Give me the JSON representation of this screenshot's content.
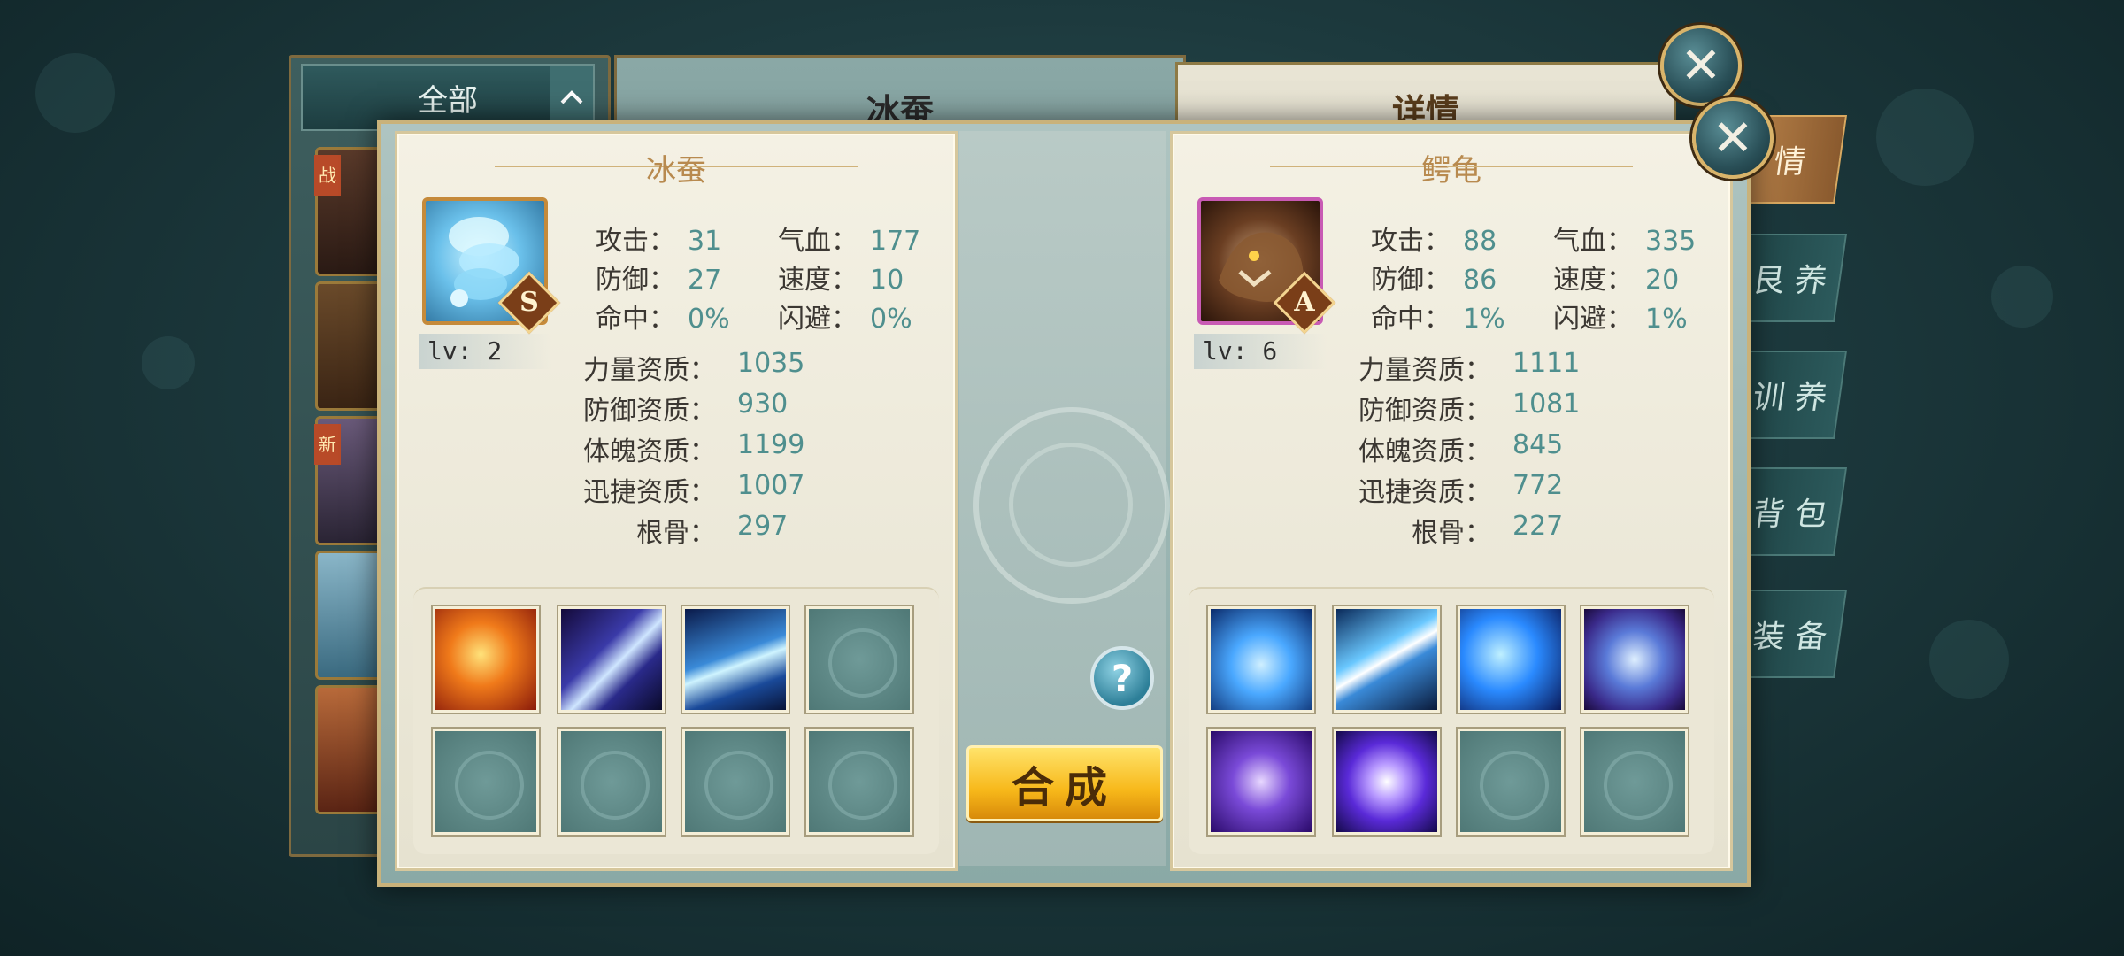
{
  "background_list": {
    "filter_label": "全部",
    "pet_tags": [
      "战",
      "新"
    ]
  },
  "background_main": {
    "pet_name": "冰蚕",
    "detail_title": "详情"
  },
  "side_tabs": [
    "情",
    "艮 养",
    "训 养",
    "背 包",
    "装 备"
  ],
  "left_pet": {
    "name": "冰蚕",
    "grade": "S",
    "level": "lv: 2",
    "stats": [
      {
        "label": "攻击：",
        "value": "31"
      },
      {
        "label": "气血：",
        "value": "177"
      },
      {
        "label": "防御：",
        "value": "27"
      },
      {
        "label": "速度：",
        "value": "10"
      },
      {
        "label": "命中：",
        "value": "0%"
      },
      {
        "label": "闪避：",
        "value": "0%"
      }
    ],
    "aptitudes": [
      {
        "label": "力量资质：",
        "value": "1035"
      },
      {
        "label": "防御资质：",
        "value": "930"
      },
      {
        "label": "体魄资质：",
        "value": "1199"
      },
      {
        "label": "迅捷资质：",
        "value": "1007"
      },
      {
        "label": "根骨：",
        "value": "297"
      }
    ],
    "skills": [
      "fire-orb-skill-icon",
      "claw-slash-skill-icon",
      "ice-shard-skill-icon",
      "empty",
      "empty",
      "empty",
      "empty",
      "empty"
    ]
  },
  "right_pet": {
    "name": "鳄龟",
    "grade": "A",
    "level": "lv: 6",
    "stats": [
      {
        "label": "攻击：",
        "value": "88"
      },
      {
        "label": "气血：",
        "value": "335"
      },
      {
        "label": "防御：",
        "value": "86"
      },
      {
        "label": "速度：",
        "value": "20"
      },
      {
        "label": "命中：",
        "value": "1%"
      },
      {
        "label": "闪避：",
        "value": "1%"
      }
    ],
    "aptitudes": [
      {
        "label": "力量资质：",
        "value": "1111"
      },
      {
        "label": "防御资质：",
        "value": "1081"
      },
      {
        "label": "体魄资质：",
        "value": "845"
      },
      {
        "label": "迅捷资质：",
        "value": "772"
      },
      {
        "label": "根骨：",
        "value": "227"
      }
    ],
    "skills": [
      "water-heart-skill-icon",
      "lightning-skill-icon",
      "blue-beast-skill-icon",
      "shield-skill-icon",
      "void-vortex-skill-icon",
      "energy-orb-skill-icon",
      "empty",
      "empty"
    ]
  },
  "actions": {
    "help_label": "?",
    "merge_label": "合成"
  },
  "colors": {
    "accent_gold": "#c9b27a",
    "stat_value": "#4f8f8e",
    "merge_button": "#f7b81a"
  }
}
